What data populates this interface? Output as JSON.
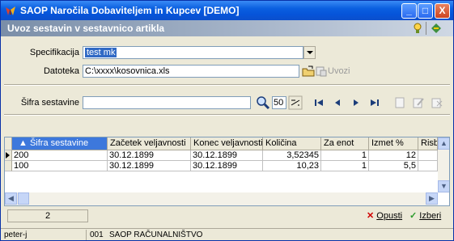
{
  "window": {
    "title": "SAOP  Naročila Dobaviteljem in Kupcev [DEMO]",
    "controls": {
      "minimize": "_",
      "maximize": "□",
      "close": "X"
    }
  },
  "subheader": {
    "title": "Uvoz sestavin v sestavnico artikla"
  },
  "form": {
    "spec_label": "Specifikacija",
    "spec_value": "test mk",
    "file_label": "Datoteka",
    "file_value": "C:\\xxxx\\kosovnica.xls",
    "import_label": "Uvozi"
  },
  "search": {
    "label": "Šifra sestavine",
    "value": "",
    "count": "50"
  },
  "grid": {
    "columns": [
      "Šifra sestavine",
      "Začetek veljavnosti",
      "Konec veljavnosti",
      "Količina",
      "Za enot",
      "Izmet %",
      "Risba"
    ],
    "rows": [
      [
        "200",
        "30.12.1899",
        "30.12.1899",
        "3,52345",
        "1",
        "12",
        ""
      ],
      [
        "100",
        "30.12.1899",
        "30.12.1899",
        "10,23",
        "1",
        "5,5",
        ""
      ]
    ]
  },
  "footer": {
    "record_count": "2",
    "cancel_label": "Opusti",
    "select_label": "Izberi"
  },
  "status": {
    "user": "peter-j",
    "company_code": "001",
    "company_name": "SAOP RAČUNALNIŠTVO"
  },
  "colors": {
    "titlebar": "#0a5fe0",
    "selection": "#316ac5",
    "active_header": "#3d78dc"
  }
}
